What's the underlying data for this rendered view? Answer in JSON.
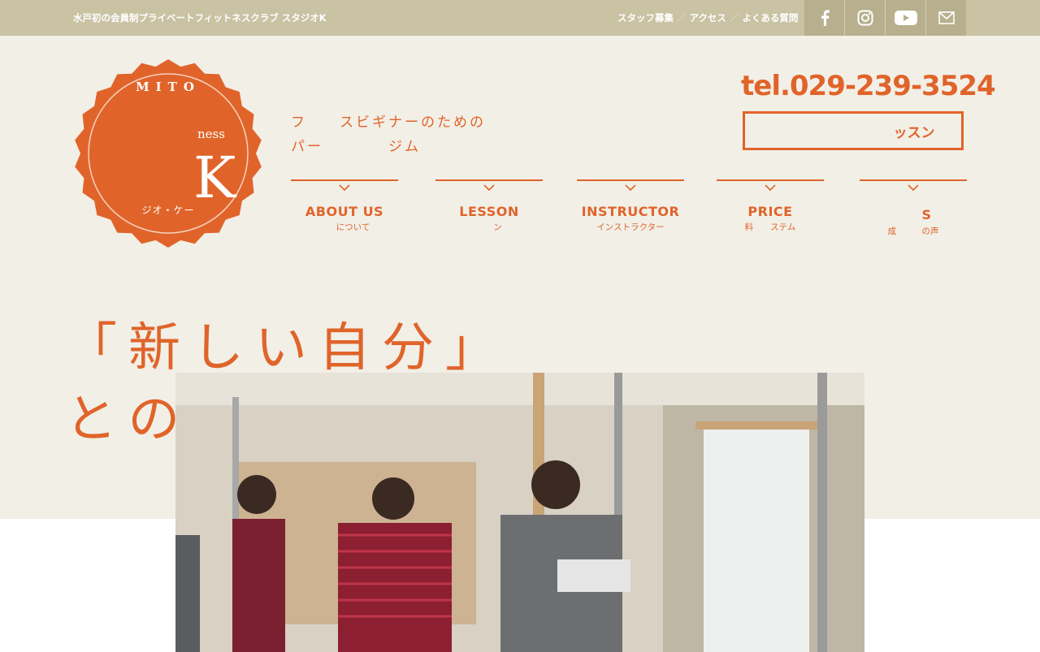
{
  "topbar": {
    "tagline": "水戸初の会員制プライベートフィットネスクラブ スタジオK",
    "links": [
      "スタッフ募集",
      "アクセス",
      "よくある質問"
    ],
    "separator": "／",
    "social": [
      {
        "icon": "facebook-icon"
      },
      {
        "icon": "instagram-icon"
      },
      {
        "icon": "youtube-icon"
      },
      {
        "icon": "mail-icon"
      }
    ]
  },
  "logo": {
    "top_text": "MITO",
    "middle_text": "ness",
    "big_letter": "K",
    "bottom_text": "ジオ・ケー"
  },
  "catchcopy": {
    "line1": "フ　　スビギナーのための",
    "line2": "パー　　　　ジム"
  },
  "contact": {
    "tel": "tel.029-239-3524",
    "trial_label": "ッスン"
  },
  "nav": [
    {
      "en": "ABOUT US",
      "ja": "　　について"
    },
    {
      "en": "LESSON",
      "ja": "　　ン"
    },
    {
      "en": "INSTRUCTOR",
      "ja": "インストラクター"
    },
    {
      "en": "PRICE",
      "ja": "料　　ステム"
    },
    {
      "en": "　　S",
      "ja": "成　　　の声"
    }
  ],
  "headline": {
    "line1": "「新しい自分」",
    "line2": "との出会い。"
  },
  "colors": {
    "accent": "#e0642a",
    "topbar": "#c9c2a3",
    "hero_bg": "#f2efe7"
  }
}
